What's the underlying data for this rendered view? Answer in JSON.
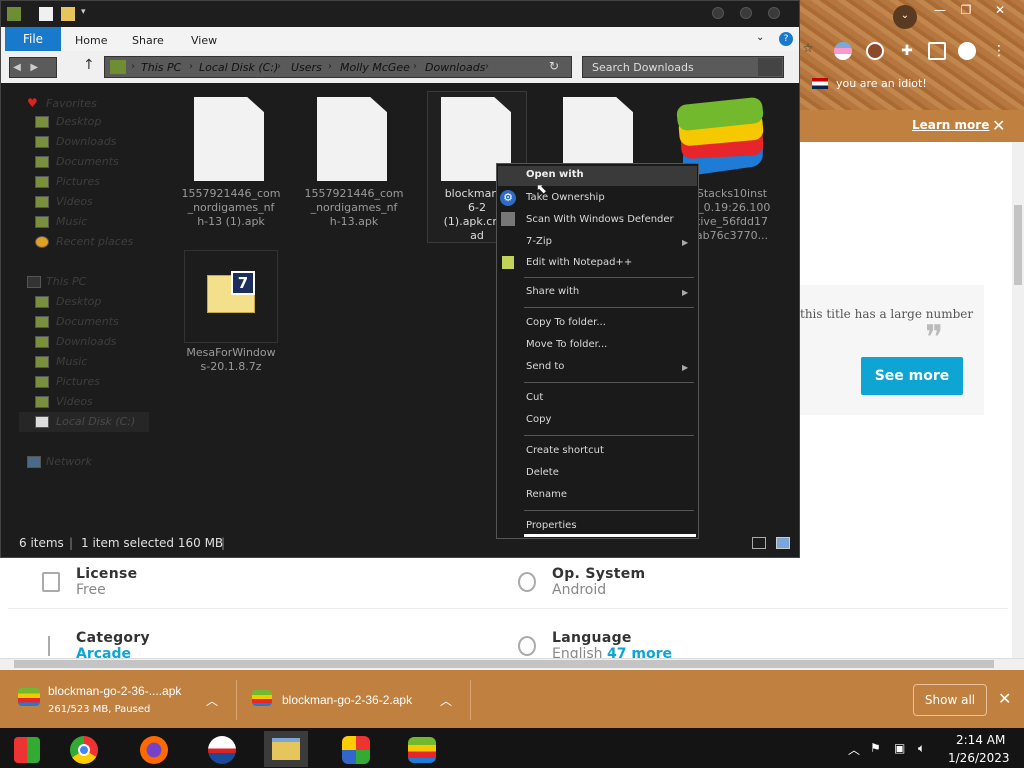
{
  "explorer": {
    "ribbon_tabs": {
      "file": "File",
      "home": "Home",
      "share": "Share",
      "view": "View"
    },
    "breadcrumb": [
      "This PC",
      "Local Disk (C:)",
      "Users",
      "Molly McGee",
      "Downloads"
    ],
    "search_placeholder": "Search Downloads",
    "nav": {
      "favorites": "Favorites",
      "favorites_items": [
        "Desktop",
        "Downloads",
        "Documents",
        "Pictures",
        "Videos",
        "Music",
        "Recent places"
      ],
      "this_pc": "This PC",
      "this_pc_items": [
        "Desktop",
        "Documents",
        "Downloads",
        "Music",
        "Pictures",
        "Videos",
        "Local Disk (C:)"
      ],
      "network": "Network"
    },
    "files": [
      {
        "name": "1557921446_com_nordigames_nfh-13 (1).apk"
      },
      {
        "name": "1557921446_com_nordigames_nfh-13.apk"
      },
      {
        "name": "blockman-go-2-36-2 (1).apk.crdownload"
      },
      {
        "name": ""
      },
      {
        "name": "BlueStacks10Installer_0.19:26.100_native_56fdd17...ab76c3770..."
      },
      {
        "name": "MesaForWindows-20.1.8.7z"
      }
    ],
    "file_name_visible": {
      "f1": "1557921446_com\n_nordigames_nf\nh-13 (1).apk",
      "f2": "1557921446_com\n_nordigames_nf\nh-13.apk",
      "f3": "blockman-g\n6-2\n(1).apk.crdo\nad",
      "f5": "Stacks10inst\nr_0.19:26.100\ntive_56fdd17\nab76c3770...",
      "f6": "MesaForWindow\ns-20.1.8.7z"
    },
    "status": {
      "items": "6 items",
      "selected": "1 item selected  160 MB"
    }
  },
  "context_menu": {
    "open_with": "Open with",
    "take_ownership": "Take Ownership",
    "scan": "Scan With Windows Defender",
    "zip": "7-Zip",
    "notepad": "Edit with Notepad++",
    "share_with": "Share with",
    "copy_to": "Copy To folder...",
    "move_to": "Move To folder...",
    "send_to": "Send to",
    "cut": "Cut",
    "copy": "Copy",
    "create_shortcut": "Create shortcut",
    "delete": "Delete",
    "rename": "Rename",
    "properties": "Properties"
  },
  "browser": {
    "bookmark_text": "you are an idiot!",
    "learn_more": "Learn more",
    "card_text": "this title has a large number of",
    "see_more": "See more",
    "license_label": "License",
    "license_value": "Free",
    "os_label": "Op. System",
    "os_value": "Android",
    "category_label": "Category",
    "category_value": "Arcade",
    "language_label": "Language",
    "language_value": "English",
    "language_more": "47 more"
  },
  "downloads": [
    {
      "name": "blockman-go-2-36-....apk",
      "status": "261/523 MB, Paused"
    },
    {
      "name": "blockman-go-2-36-2.apk",
      "status": ""
    }
  ],
  "downloads_show_all": "Show all",
  "clock": {
    "time": "2:14 AM",
    "date": "1/26/2023"
  },
  "colors": {
    "file_tab": "#1979ca",
    "accent_button": "#0ea5d2",
    "download_bar": "#c0803f"
  }
}
